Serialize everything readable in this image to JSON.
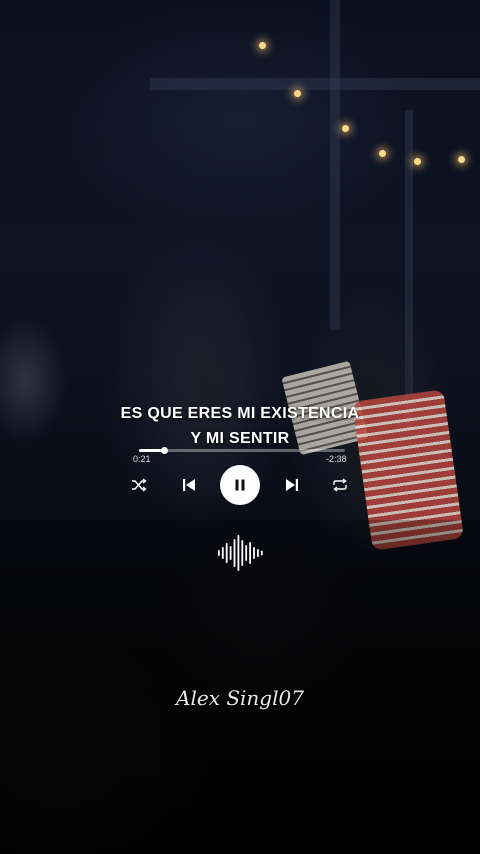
{
  "lyrics": {
    "line1": "ES QUE ERES MI EXISTENCIA",
    "line2": "Y MI SENTIR"
  },
  "player": {
    "elapsed": "0:21",
    "remaining": "-2:38",
    "progress": 0.12,
    "state": "playing",
    "icons": {
      "shuffle": "shuffle-icon",
      "previous": "previous-icon",
      "pause": "pause-icon",
      "next": "next-icon",
      "repeat": "repeat-icon",
      "waveform": "waveform-icon"
    }
  },
  "watermark": {
    "text": "Alex Singl07"
  },
  "colors": {
    "text": "#ffffff",
    "play_button": "#ffffff",
    "background": "#0b1020"
  }
}
